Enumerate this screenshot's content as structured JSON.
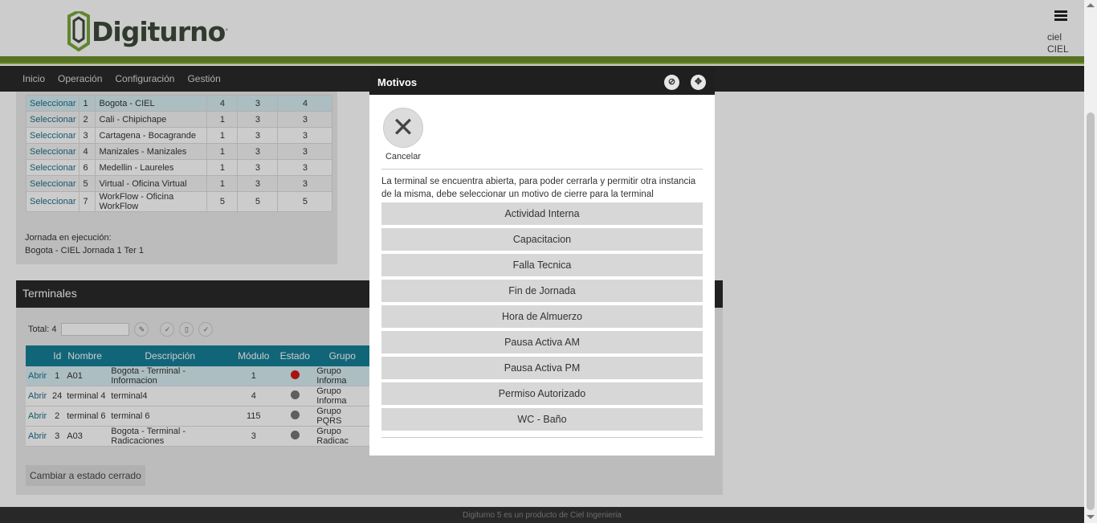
{
  "header": {
    "brand": "Digiturno",
    "brand_tm": "°",
    "user_name": "ciel",
    "user_org": "CIEL"
  },
  "nav": {
    "items": [
      "Inicio",
      "Operación",
      "Configuración",
      "Gestión"
    ]
  },
  "offices": {
    "rows": [
      {
        "action": "Seleccionar",
        "id": "1",
        "name": "Bogota - CIEL",
        "a": "4",
        "b": "3",
        "c": "4"
      },
      {
        "action": "Seleccionar",
        "id": "2",
        "name": "Cali - Chipichape",
        "a": "1",
        "b": "3",
        "c": "3"
      },
      {
        "action": "Seleccionar",
        "id": "3",
        "name": "Cartagena - Bocagrande",
        "a": "1",
        "b": "3",
        "c": "3"
      },
      {
        "action": "Seleccionar",
        "id": "4",
        "name": "Manizales - Manizales",
        "a": "1",
        "b": "3",
        "c": "3"
      },
      {
        "action": "Seleccionar",
        "id": "6",
        "name": "Medellin - Laureles",
        "a": "1",
        "b": "3",
        "c": "3"
      },
      {
        "action": "Seleccionar",
        "id": "5",
        "name": "Virtual - Oficina Virtual",
        "a": "1",
        "b": "3",
        "c": "3"
      },
      {
        "action": "Seleccionar",
        "id": "7",
        "name": "WorkFlow - Oficina WorkFlow",
        "a": "5",
        "b": "5",
        "c": "5"
      }
    ],
    "jornada_label": "Jornada en ejecución:",
    "jornada_value": "Bogota - CIEL Jornada 1 Ter 1"
  },
  "terminals": {
    "title": "Terminales",
    "total_label": "Total:",
    "total_value": "4",
    "columns": [
      "",
      "Id",
      "Nombre",
      "Descripción",
      "Módulo",
      "Estado",
      "Grupo"
    ],
    "rows": [
      {
        "action": "Abrir",
        "id": "1",
        "name": "A01",
        "desc": "Bogota - Terminal - Informacion",
        "module": "1",
        "status": "red",
        "group": "Grupo Informa"
      },
      {
        "action": "Abrir",
        "id": "24",
        "name": "terminal 4",
        "desc": "terminal4",
        "module": "4",
        "status": "gray",
        "group": "Grupo Informa"
      },
      {
        "action": "Abrir",
        "id": "2",
        "name": "terminal 6",
        "desc": "terminal 6",
        "module": "115",
        "status": "gray",
        "group": "Grupo PQRS"
      },
      {
        "action": "Abrir",
        "id": "3",
        "name": "A03",
        "desc": "Bogota - Terminal - Radicaciones",
        "module": "3",
        "status": "gray",
        "group": "Grupo Radicac"
      }
    ],
    "close_button": "Cambiar a estado cerrado"
  },
  "footer": "Digiturno 5 es un producto de Ciel Ingenieria",
  "modal": {
    "title": "Motivos",
    "cancel_label": "Cancelar",
    "message": "La terminal se encuentra abierta, para poder cerrarla y permitir otra instancia de la misma, debe seleccionar un motivo de cierre para la terminal",
    "reasons": [
      "Actividad Interna",
      "Capacitacion",
      "Falla Tecnica",
      "Fin de Jornada",
      "Hora de Almuerzo",
      "Pausa Activa AM",
      "Pausa Activa PM",
      "Permiso Autorizado",
      "WC - Baño"
    ]
  },
  "icons": {
    "hide": "eye-slash-icon",
    "move": "move-arrows-icon",
    "cancel": "close-x-icon",
    "menu": "hamburger-menu-icon"
  },
  "colors": {
    "brand_green": "#6f8f2c",
    "table_header": "#167f98",
    "status_red": "#d11a1a"
  }
}
